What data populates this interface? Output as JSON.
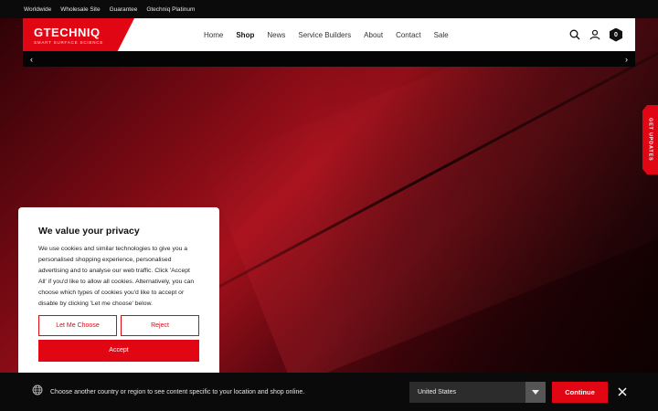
{
  "topbar": {
    "links": [
      "Worldwide",
      "Wholesale Site",
      "Guarantee",
      "Gtechniq Platinum"
    ]
  },
  "header": {
    "logo_text": "GTECHNIQ",
    "logo_tagline": "SMART SURFACE SCIENCE",
    "nav": [
      "Home",
      "Shop",
      "News",
      "Service Builders",
      "About",
      "Contact",
      "Sale"
    ],
    "active_nav": "Shop",
    "cart_count": "0"
  },
  "slider": {
    "prev": "‹",
    "next": "›"
  },
  "updates_tab": {
    "label": "GET UPDATES"
  },
  "privacy": {
    "title": "We value your privacy",
    "body": "We use cookies and similar technologies to give you a personalised shopping experience, personalised advertising and to analyse our web traffic. Click 'Accept All' if you'd like to allow all cookies. Alternatively, you can choose which types of cookies you'd like to accept or disable by clicking 'Let me choose' below.",
    "choose_label": "Let Me Choose",
    "reject_label": "Reject",
    "accept_label": "Accept"
  },
  "country_bar": {
    "message": "Choose another country or region to see content specific to your location and shop online.",
    "selected_country": "United States",
    "continue_label": "Continue"
  },
  "colors": {
    "brand_red": "#e10613"
  }
}
